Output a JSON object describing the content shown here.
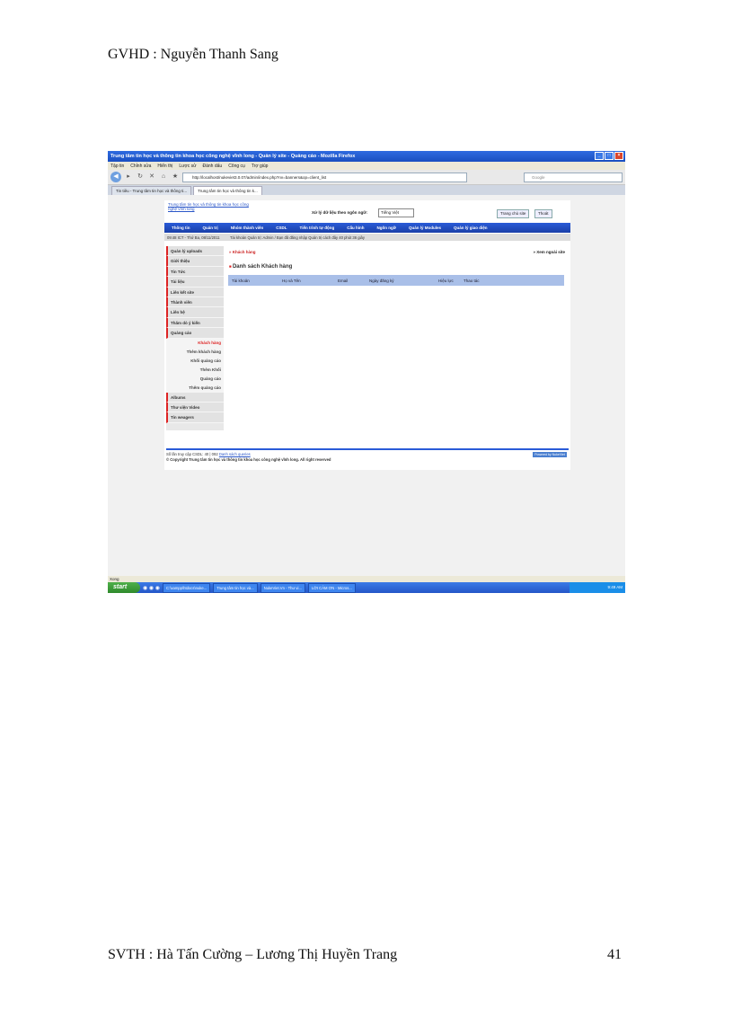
{
  "header": {
    "text": "GVHD : Nguyễn  Thanh  Sang"
  },
  "footer": {
    "left": "SVTH : Hà Tấn Cường – Lương Thị Huyền Trang",
    "page_number": "41"
  },
  "browser": {
    "title": "Trung tâm tin học và thông tin khoa học công nghệ vĩnh long - Quản lý site - Quảng cáo - Mozilla Firefox",
    "menu": [
      "Tập tin",
      "Chỉnh sửa",
      "Hiển thị",
      "Lược sử",
      "Đánh dấu",
      "Công cụ",
      "Trợ giúp"
    ],
    "url": "http://localhost/nukeviet3.0.07/admin/index.php?nv=banners&op=client_list",
    "search_placeholder": "Google",
    "tabs": [
      "Tin tiêu - Trung tâm tin học và thông ti...",
      "Trung tâm tin học và thông tin k..."
    ],
    "status": "Xong"
  },
  "site": {
    "logo_text": "Trung tâm tin học và thông tin khoa học công nghệ vĩnh long",
    "lang_label": "Xử lý dữ liệu theo ngôn ngữ:",
    "lang_value": "Tiếng Việt",
    "top_buttons": [
      "Trang chủ site",
      "Thoát"
    ],
    "nav": [
      "Thông tin",
      "Quản trị",
      "Nhóm thành viên",
      "CSDL",
      "Tiến trình tự động",
      "Cấu hình",
      "Ngôn ngữ",
      "Quản lý Modules",
      "Quản lý giao diện"
    ],
    "date": "09:48 ICT - Thứ Ba, 08/11/2011",
    "welcome": "Tài khoản Quản trị: Admin / Bạn đã đăng nhập Quản trị cách đây 40 phút 36 giây",
    "sidebar": [
      "Quản lý uploads",
      "Giới thiệu",
      "Tin Tức",
      "Tài liệu",
      "Liên kết site",
      "Thành viên",
      "Liên hệ",
      "Thăm dò ý kiến",
      "Quảng cáo"
    ],
    "sidebar_sub": [
      "Khách hàng",
      "Thêm khách hàng",
      "Khối quảng cáo",
      "Thêm Khối",
      "Quảng cáo",
      "Thêm quảng cáo"
    ],
    "sidebar_after": [
      "Albums",
      "Thư viện Video",
      "Tin weagers"
    ],
    "breadcrumb": "» Khách hàng",
    "view_site": "» Xem ngoài site",
    "section_title": "Danh sách Khách hàng",
    "table_headers": [
      "Tài khoản",
      "Họ và Tên",
      "Email",
      "Ngày đăng ký",
      "Hiệu lực",
      "Thao tác"
    ],
    "footer_stats": "Số lần truy cập CSDL: 40 | 092",
    "footer_link": "Danh sách queries",
    "copyright": "© Copyright Trung tâm tin học và thông tin khoa học công nghệ vĩnh long. All right reserved",
    "badge": "Powered by NukeViet"
  },
  "taskbar": {
    "start": "start",
    "tasks": [
      "C:\\xampp\\htdocs\\nuke...",
      "Trung tâm tin học và...",
      "NukeViet.Vn - Thư vi...",
      "LỜI CẢM ƠN - Micros..."
    ],
    "clock": "9:49 AM"
  }
}
